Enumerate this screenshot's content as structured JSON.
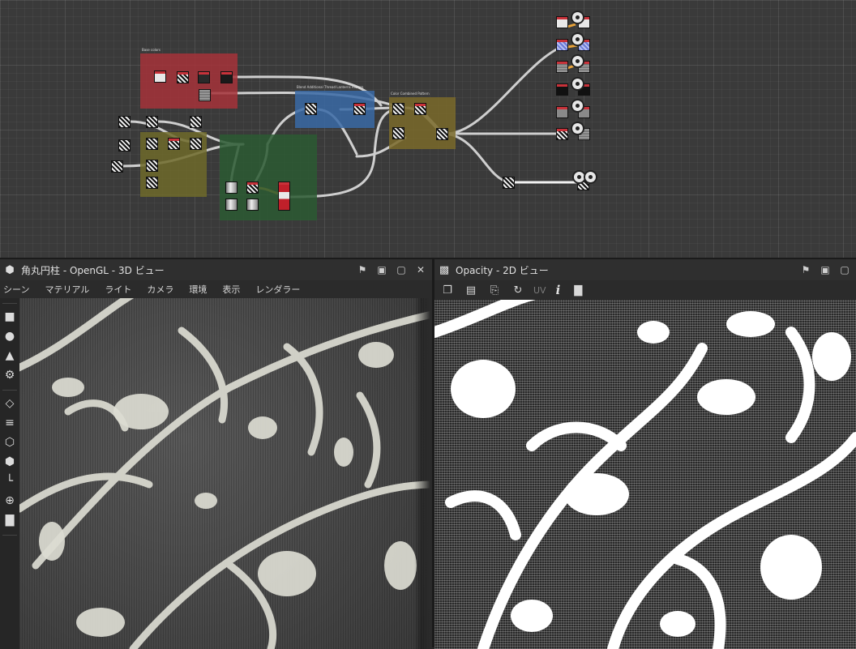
{
  "graph": {
    "frames": [
      {
        "name": "frame-red",
        "title": "Base colors",
        "color": "#a6333a"
      },
      {
        "name": "frame-yellow",
        "title": "",
        "color": "#6f6a2a"
      },
      {
        "name": "frame-green",
        "title": "",
        "color": "#2c5a33"
      },
      {
        "name": "frame-blue",
        "title": "Blend Additional Thread Lanterns Pattern",
        "color": "#3a6aa6"
      },
      {
        "name": "frame-orange",
        "title": "Color Combined Pattern",
        "color": "#7a6a2a"
      }
    ]
  },
  "panel3d": {
    "icon": "cube-icon",
    "title": "角丸円柱 - OpenGL - 3D ビュー",
    "menu": [
      "シーン",
      "マテリアル",
      "ライト",
      "カメラ",
      "環境",
      "表示",
      "レンダラー"
    ]
  },
  "panel2d": {
    "icon": "checker-icon",
    "title": "Opacity - 2D ビュー",
    "uv_label": "UV",
    "info_label": "i"
  },
  "colors": {
    "accent_orange": "#e8a33a",
    "node_header_red": "#c8323a"
  }
}
